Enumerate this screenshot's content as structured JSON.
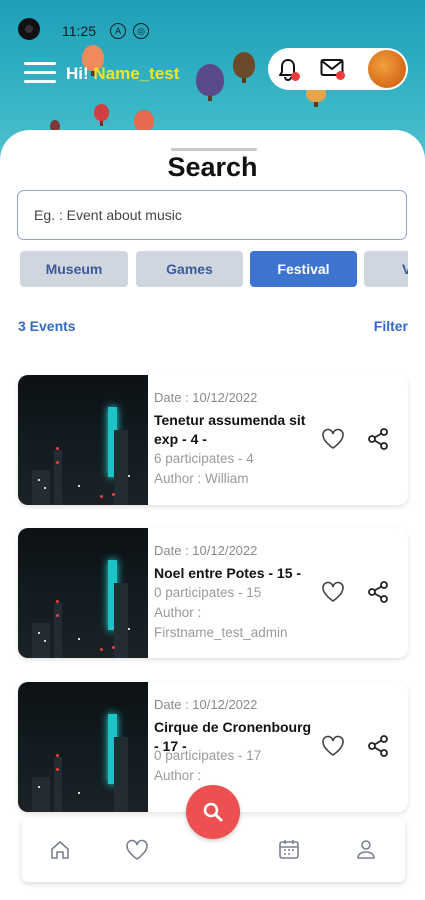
{
  "status_bar": {
    "time": "11:25",
    "icons": [
      "a-icon",
      "circle-icon"
    ]
  },
  "header": {
    "greeting_prefix": "Hi!",
    "username": "Name_test",
    "icons": {
      "notifications": "bell-icon",
      "messages": "mail-icon"
    },
    "badge_color": "#ee3b3b"
  },
  "search": {
    "title": "Search",
    "input_value": "",
    "placeholder": "Eg. : Event about music"
  },
  "categories": [
    {
      "label": "Museum",
      "active": false
    },
    {
      "label": "Games",
      "active": false
    },
    {
      "label": "Festival",
      "active": true
    },
    {
      "label": "V",
      "active": false
    }
  ],
  "results": {
    "count_label": "3 Events",
    "filter_label": "Filter"
  },
  "events": [
    {
      "date": "Date : 10/12/2022",
      "title": "Tenetur assumenda sit exp - 4 -",
      "participants": "6 participates - 4",
      "author": "Author : William"
    },
    {
      "date": "Date : 10/12/2022",
      "title": "Noel entre Potes - 15 -",
      "participants": "0 participates - 15",
      "author": "Author : Firstname_test_admin"
    },
    {
      "date": "Date : 10/12/2022",
      "title": "Cirque de Cronenbourg - 17 -",
      "participants": "0 participates - 17",
      "author": "Author :"
    }
  ],
  "bottom_nav": {
    "items": [
      "home-icon",
      "heart-icon",
      "search-icon",
      "calendar-icon",
      "user-icon"
    ],
    "fab_color": "#ec5050"
  },
  "colors": {
    "accent": "#3c74d0",
    "link": "#3569c6",
    "greeting_name": "#f5e51c"
  }
}
